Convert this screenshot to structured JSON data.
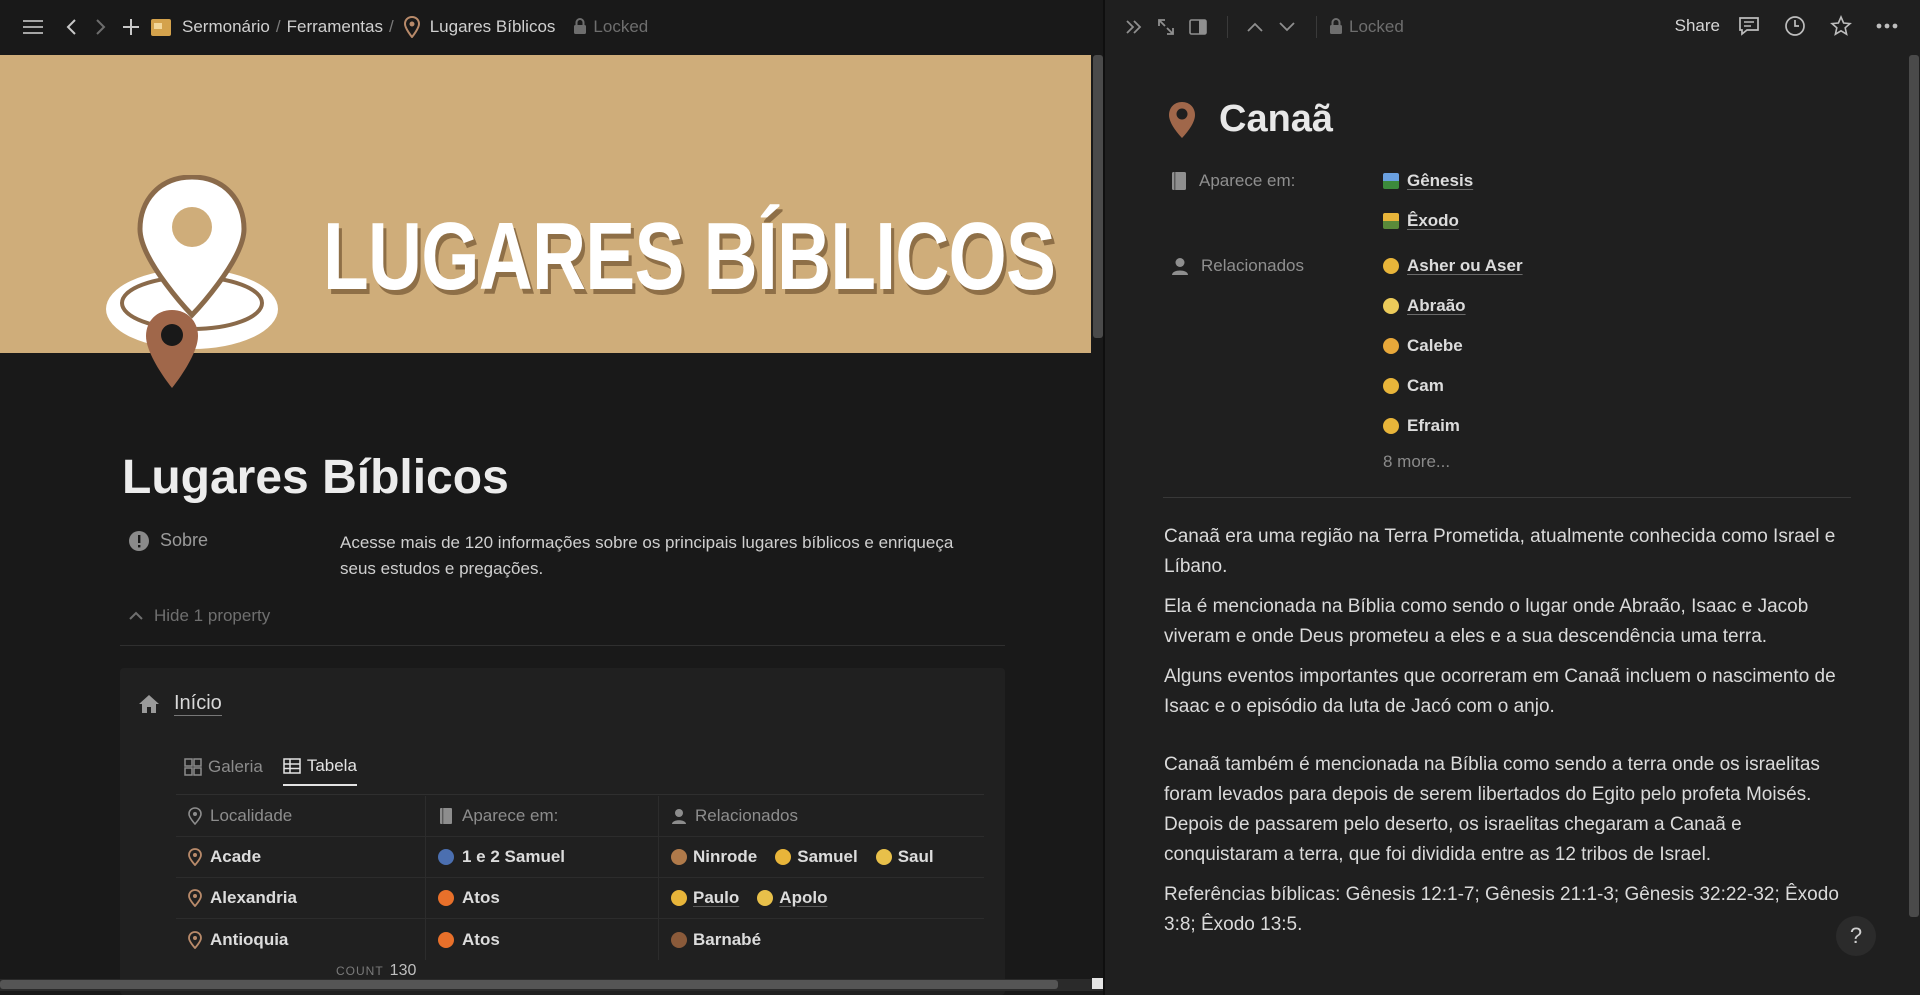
{
  "topbar": {
    "breadcrumb": [
      "Sermonário",
      "Ferramentas",
      "Lugares Bíblicos"
    ],
    "lock": "Locked"
  },
  "cover": {
    "title": "LUGARES BÍBLICOS"
  },
  "page": {
    "title": "Lugares Bíblicos",
    "property_name": "Sobre",
    "property_value": "Acesse mais de 120 informações sobre os principais lugares bíblicos e enriqueça seus estudos e pregações.",
    "hide_property": "Hide 1 property"
  },
  "callout": {
    "title": "Início",
    "tabs": [
      "Galeria",
      "Tabela"
    ],
    "columns": [
      "Localidade",
      "Aparece em:",
      "Relacionados"
    ],
    "rows": [
      {
        "local": "Acade",
        "book": "1 e 2 Samuel",
        "rel": [
          "Ninrode",
          "Samuel",
          "Saul"
        ]
      },
      {
        "local": "Alexandria",
        "book": "Atos",
        "rel": [
          "Paulo",
          "Apolo"
        ]
      },
      {
        "local": "Antioquia",
        "book": "Atos",
        "rel": [
          "Barnabé"
        ]
      }
    ],
    "count_label": "COUNT",
    "count_value": "130"
  },
  "right": {
    "lock": "Locked",
    "share": "Share",
    "title": "Canaã",
    "prop1_name": "Aparece em:",
    "prop1_values": [
      "Gênesis",
      "Êxodo"
    ],
    "prop2_name": "Relacionados",
    "prop2_values": [
      "Asher ou Aser",
      "Abraão",
      "Calebe",
      "Cam",
      "Efraim"
    ],
    "more": "8 more...",
    "body": [
      "Canaã era uma região na Terra Prometida, atualmente conhecida como Israel e Líbano.",
      "Ela é mencionada na Bíblia como sendo o lugar onde Abraão, Isaac e Jacob viveram e onde Deus prometeu a eles e a sua descendência uma terra.",
      "Alguns eventos importantes que ocorreram em Canaã incluem o nascimento de Isaac e o episódio da luta de Jacó com o anjo.",
      "Canaã também é mencionada na Bíblia como sendo a terra onde os israelitas foram levados para depois de serem libertados do Egito pelo profeta Moisés. Depois de passarem pelo deserto, os israelitas chegaram a Canaã e conquistaram a terra, que foi dividida entre as 12 tribos de Israel.",
      "Referências bíblicas: Gênesis 12:1-7; Gênesis 21:1-3; Gênesis 32:22-32; Êxodo 3:8; Êxodo 13:5."
    ],
    "help": "?"
  },
  "colors": {
    "cover": "#cfad7a",
    "pin": "#a0674a",
    "bg": "#191919",
    "panel": "#1f1f1f"
  }
}
